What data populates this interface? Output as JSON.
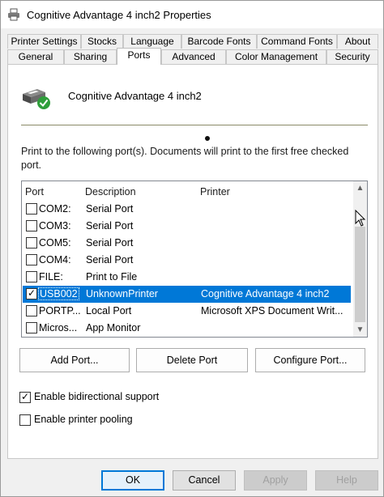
{
  "window": {
    "title": "Cognitive Advantage 4 inch2 Properties"
  },
  "tabs_row1": [
    {
      "label": "Printer Settings"
    },
    {
      "label": "Stocks"
    },
    {
      "label": "Language"
    },
    {
      "label": "Barcode Fonts"
    },
    {
      "label": "Command Fonts"
    },
    {
      "label": "About"
    }
  ],
  "tabs_row2": [
    {
      "label": "General"
    },
    {
      "label": "Sharing"
    },
    {
      "label": "Ports",
      "selected": true
    },
    {
      "label": "Advanced"
    },
    {
      "label": "Color Management"
    },
    {
      "label": "Security"
    }
  ],
  "panel": {
    "printer_name": "Cognitive Advantage 4 inch2",
    "description": "Print to the following port(s). Documents will print to the first free checked port.",
    "columns": [
      "Port",
      "Description",
      "Printer"
    ],
    "ports": [
      {
        "port": "COM2:",
        "description": "Serial Port",
        "printer": "",
        "checked": false,
        "selected": false
      },
      {
        "port": "COM3:",
        "description": "Serial Port",
        "printer": "",
        "checked": false,
        "selected": false
      },
      {
        "port": "COM5:",
        "description": "Serial Port",
        "printer": "",
        "checked": false,
        "selected": false
      },
      {
        "port": "COM4:",
        "description": "Serial Port",
        "printer": "",
        "checked": false,
        "selected": false
      },
      {
        "port": "FILE:",
        "description": "Print to File",
        "printer": "",
        "checked": false,
        "selected": false
      },
      {
        "port": "USB002",
        "description": "UnknownPrinter",
        "printer": "Cognitive Advantage 4 inch2",
        "checked": true,
        "selected": true
      },
      {
        "port": "PORTP...",
        "description": "Local Port",
        "printer": "Microsoft XPS Document Writ...",
        "checked": false,
        "selected": false
      },
      {
        "port": "Micros...",
        "description": "App Monitor",
        "printer": "",
        "checked": false,
        "selected": false
      }
    ],
    "add_port": "Add Port...",
    "delete_port": "Delete Port",
    "configure_port": "Configure Port...",
    "bidirectional": {
      "label": "Enable bidirectional support",
      "checked": true
    },
    "pooling": {
      "label": "Enable printer pooling",
      "checked": false
    }
  },
  "dialog_buttons": {
    "ok": "OK",
    "cancel": "Cancel",
    "apply": "Apply",
    "help": "Help"
  },
  "colors": {
    "selection": "#0078d7",
    "default_button_border": "#0078d7",
    "check_badge": "#2e9e3a"
  }
}
